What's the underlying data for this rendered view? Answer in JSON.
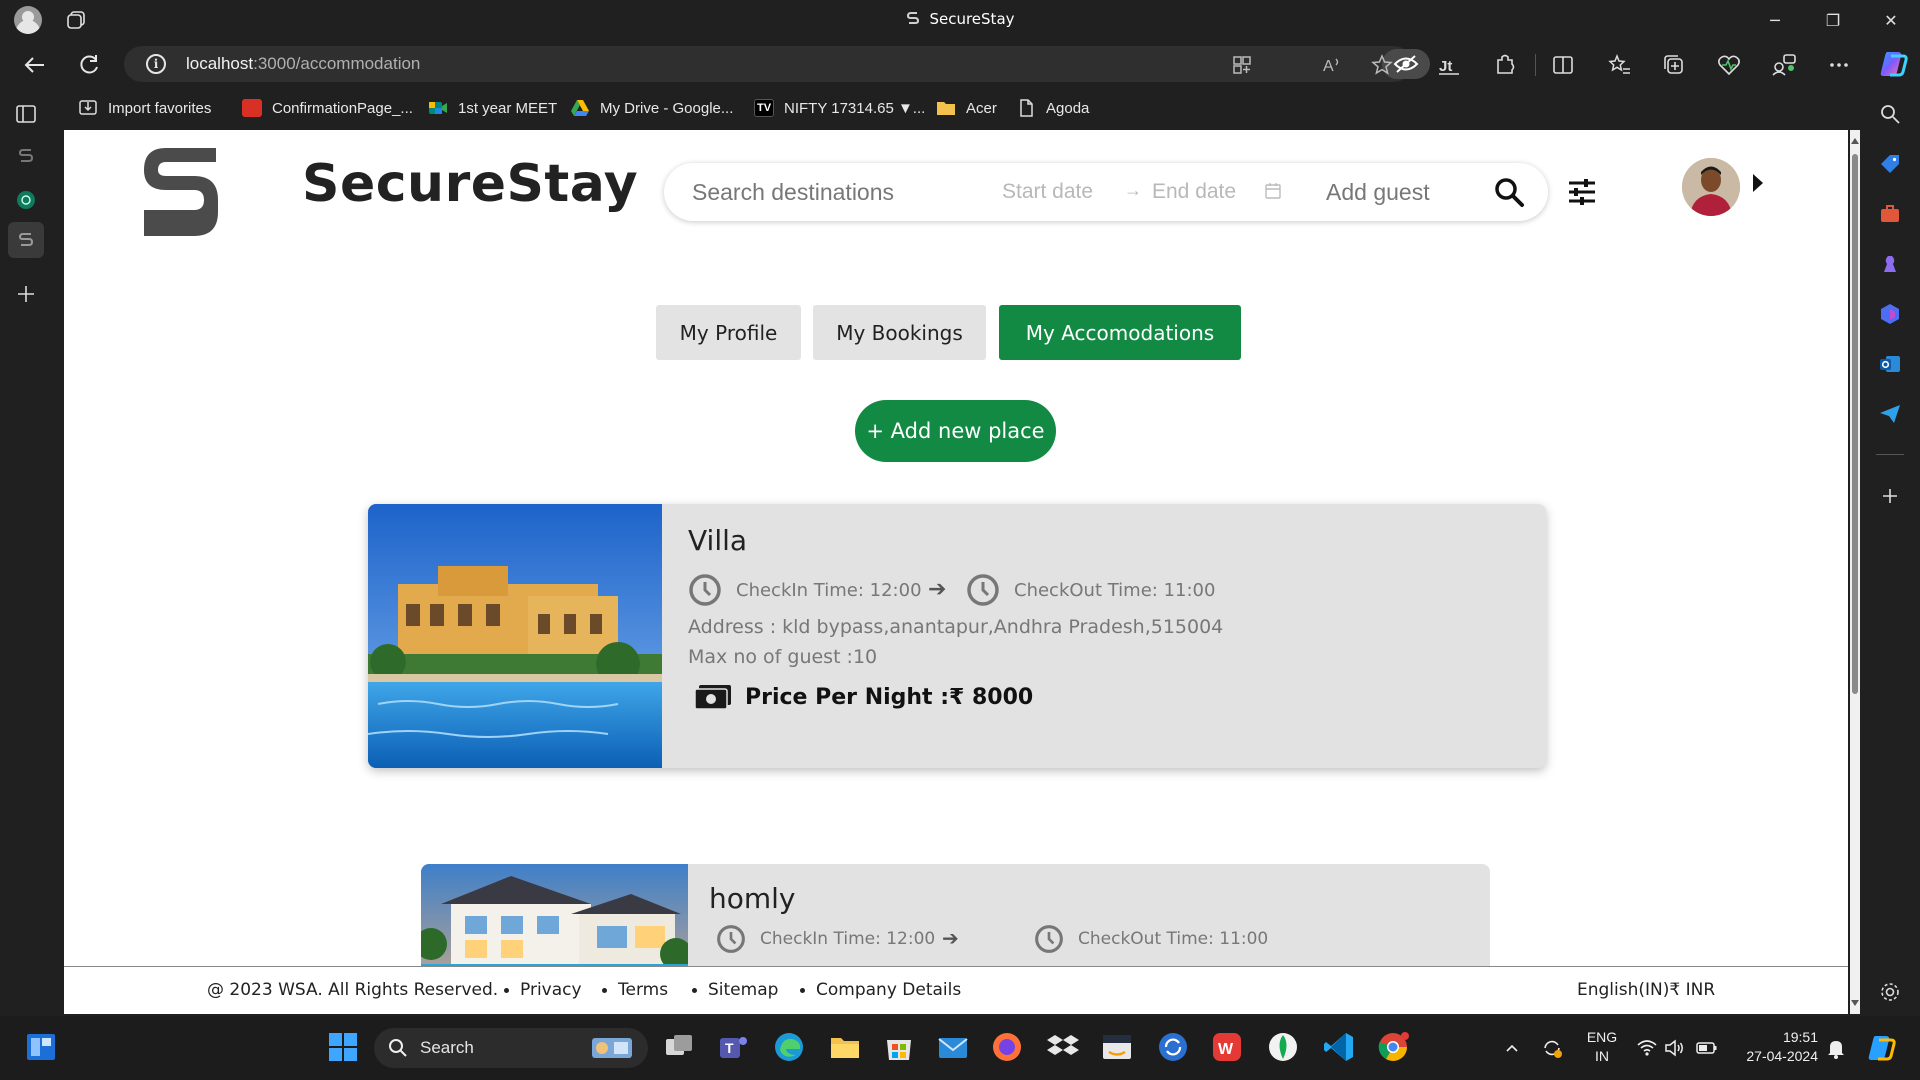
{
  "window": {
    "title": "SecureStay",
    "minimize_glyph": "─",
    "restore_glyph": "❐",
    "close_glyph": "✕"
  },
  "address": {
    "host": "localhost",
    "path": ":3000/accommodation"
  },
  "favorites": [
    {
      "label": "Import favorites",
      "icon": "import-icon",
      "color": "#202020"
    },
    {
      "label": "ConfirmationPage_...",
      "icon": "pdf-icon",
      "color": "#d93025"
    },
    {
      "label": "1st year MEET",
      "icon": "meet-icon",
      "color": "#00897b"
    },
    {
      "label": "My Drive - Google...",
      "icon": "drive-icon",
      "color": "#fbbc04"
    },
    {
      "label": "NIFTY 17314.65 ▼...",
      "icon": "tradingview-icon",
      "color": "#000000"
    },
    {
      "label": "Acer",
      "icon": "folder-icon",
      "color": "#f2c14e"
    },
    {
      "label": "Agoda",
      "icon": "page-icon",
      "color": "#202020"
    }
  ],
  "site": {
    "brand": "SecureStay",
    "search": {
      "destination_placeholder": "Search destinations",
      "start_date_placeholder": "Start date",
      "end_date_placeholder": "End date",
      "guest_placeholder": "Add guest"
    },
    "tabs": [
      {
        "label": "My Profile",
        "active": false
      },
      {
        "label": "My Bookings",
        "active": false
      },
      {
        "label": "My Accomodations",
        "active": true
      }
    ],
    "add_place_label": "+ Add new place",
    "accent_color": "#128a43"
  },
  "places": [
    {
      "name": "Villa",
      "checkin": "CheckIn Time: 12:00",
      "checkout": "CheckOut Time: 11:00",
      "address": "Address : kld bypass,anantapur,Andhra Pradesh,515004",
      "guests": "Max no of guest :10",
      "price": "Price Per Night :₹ 8000"
    },
    {
      "name": "homly",
      "checkin": "CheckIn Time: 12:00",
      "checkout": "CheckOut Time: 11:00"
    }
  ],
  "footer": {
    "copyright": "@ 2023 WSA. All Rights Reserved.",
    "links": [
      "Privacy",
      "Terms",
      "Sitemap",
      "Company Details"
    ],
    "locale": "English(IN)₹ INR"
  },
  "taskbar": {
    "search_label": "Search",
    "lang_line1": "ENG",
    "lang_line2": "IN",
    "time": "19:51",
    "date": "27-04-2024"
  }
}
